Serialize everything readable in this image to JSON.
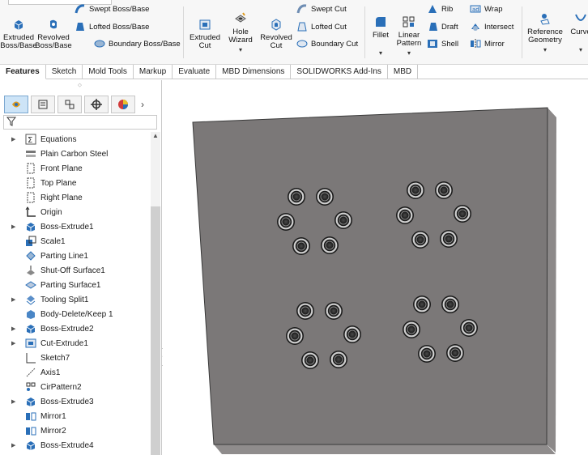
{
  "ribbon": {
    "extruded_boss": [
      "Extruded",
      "Boss/Base"
    ],
    "revolved_boss": [
      "Revolved",
      "Boss/Base"
    ],
    "swept_boss": "Swept Boss/Base",
    "lofted_boss": "Lofted Boss/Base",
    "boundary_boss": "Boundary Boss/Base",
    "extruded_cut": [
      "Extruded",
      "Cut"
    ],
    "hole_wizard": [
      "Hole",
      "Wizard"
    ],
    "revolved_cut": [
      "Revolved",
      "Cut"
    ],
    "swept_cut": "Swept Cut",
    "lofted_cut": "Lofted Cut",
    "boundary_cut": "Boundary Cut",
    "fillet": "Fillet",
    "linear_pattern": [
      "Linear",
      "Pattern"
    ],
    "rib": "Rib",
    "draft": "Draft",
    "shell": "Shell",
    "wrap": "Wrap",
    "intersect": "Intersect",
    "mirror": "Mirror",
    "reference_geometry": [
      "Reference",
      "Geometry"
    ],
    "curves": "Curve",
    "dropdown_arrow": "▾"
  },
  "tabs": [
    "Features",
    "Sketch",
    "Mold Tools",
    "Markup",
    "Evaluate",
    "MBD Dimensions",
    "SOLIDWORKS Add-Ins",
    "MBD"
  ],
  "panel": {
    "chevron": "›",
    "grip": "⬦",
    "tree": [
      {
        "label": "Equations",
        "icon": "equations-icon",
        "expand": true
      },
      {
        "label": "Plain Carbon Steel",
        "icon": "material-icon",
        "expand": false
      },
      {
        "label": "Front Plane",
        "icon": "plane-icon",
        "expand": false
      },
      {
        "label": "Top Plane",
        "icon": "plane-icon",
        "expand": false
      },
      {
        "label": "Right Plane",
        "icon": "plane-icon",
        "expand": false
      },
      {
        "label": "Origin",
        "icon": "origin-icon",
        "expand": false
      },
      {
        "label": "Boss-Extrude1",
        "icon": "extrude-icon",
        "expand": true
      },
      {
        "label": "Scale1",
        "icon": "scale-icon",
        "expand": false
      },
      {
        "label": "Parting Line1",
        "icon": "parting-line-icon",
        "expand": false
      },
      {
        "label": "Shut-Off Surface1",
        "icon": "shutoff-icon",
        "expand": false
      },
      {
        "label": "Parting Surface1",
        "icon": "parting-surface-icon",
        "expand": false
      },
      {
        "label": "Tooling Split1",
        "icon": "tooling-split-icon",
        "expand": true
      },
      {
        "label": "Body-Delete/Keep 1",
        "icon": "body-delete-icon",
        "expand": false
      },
      {
        "label": "Boss-Extrude2",
        "icon": "extrude-icon",
        "expand": true
      },
      {
        "label": "Cut-Extrude1",
        "icon": "cut-extrude-icon",
        "expand": true
      },
      {
        "label": "Sketch7",
        "icon": "sketch-icon",
        "expand": false
      },
      {
        "label": "Axis1",
        "icon": "axis-icon",
        "expand": false
      },
      {
        "label": "CirPattern2",
        "icon": "cirpattern-icon",
        "expand": false
      },
      {
        "label": "Boss-Extrude3",
        "icon": "extrude-icon",
        "expand": true
      },
      {
        "label": "Mirror1",
        "icon": "mirror-icon",
        "expand": false
      },
      {
        "label": "Mirror2",
        "icon": "mirror-icon",
        "expand": false
      },
      {
        "label": "Boss-Extrude4",
        "icon": "extrude-icon",
        "expand": true
      }
    ]
  },
  "colors": {
    "plate_face": "#7b7878",
    "plate_side": "#8a8787",
    "plate_edge": "#3a3a3a",
    "hole_ring": "#cfcfcf",
    "accent": "#2a6fb8"
  }
}
